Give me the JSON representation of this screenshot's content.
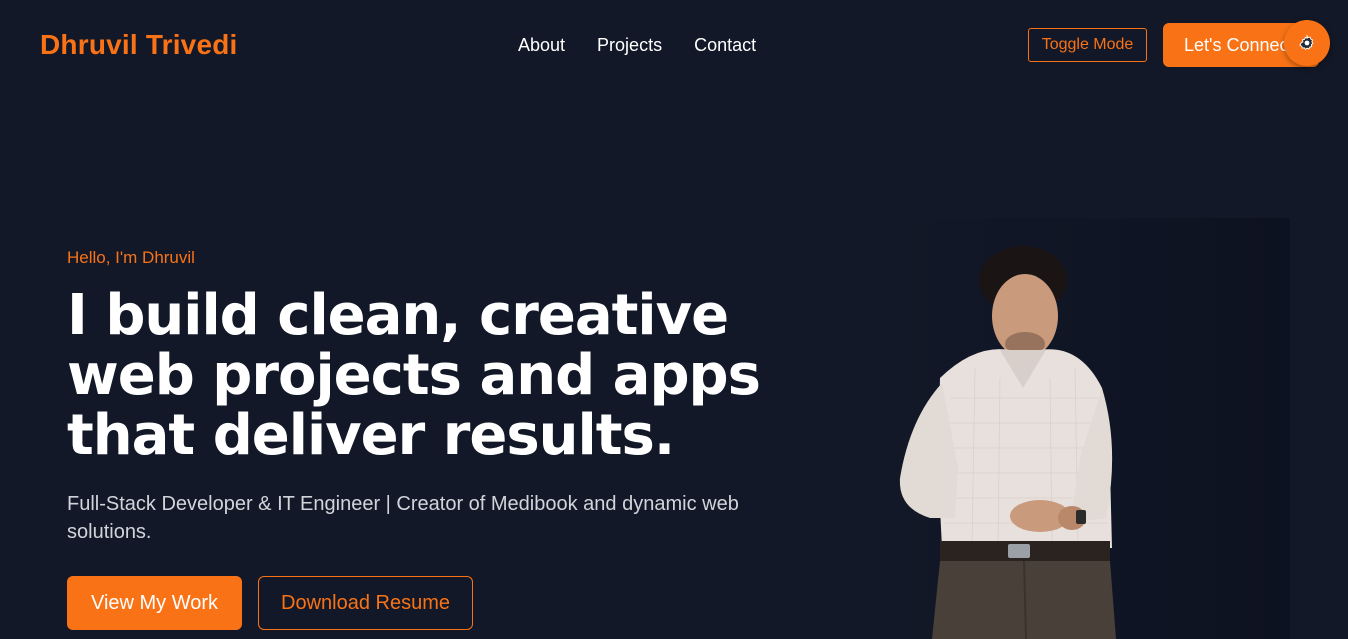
{
  "header": {
    "brand": "Dhruvil Trivedi",
    "nav": [
      {
        "label": "About"
      },
      {
        "label": "Projects"
      },
      {
        "label": "Contact"
      }
    ],
    "toggle_label": "Toggle Mode",
    "connect_label": "Let's Connect",
    "settings_icon": "gear-icon"
  },
  "hero": {
    "greeting": "Hello, I'm Dhruvil",
    "headline": "I build clean, creative web projects and apps that deliver results.",
    "subtitle": "Full-Stack Developer & IT Engineer | Creator of Medibook and dynamic web solutions.",
    "primary_cta": "View My Work",
    "secondary_cta": "Download Resume"
  },
  "colors": {
    "background": "#121827",
    "accent": "#f97316",
    "text": "#ffffff",
    "muted_text": "#d1d5db"
  }
}
